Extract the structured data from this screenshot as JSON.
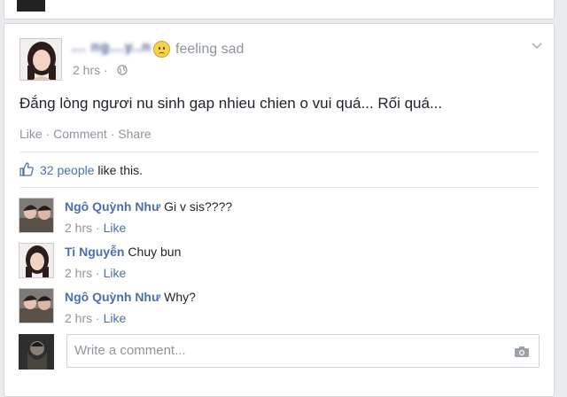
{
  "post": {
    "author": "... ng...y..n",
    "feeling": "feeling sad",
    "time": "2 hrs ·",
    "text": "Đắng lòng ngươi nu sinh gap nhieu chien o vui quá... Rối quá...",
    "actions": {
      "like": "Like",
      "sep1": " · ",
      "comment": "Comment",
      "sep2": " · ",
      "share": "Share"
    },
    "likes": {
      "count": "32 people",
      "suffix": " like this."
    }
  },
  "comments": [
    {
      "name": "Ngô Quỳnh Như",
      "text": "Gi v sis????",
      "time": "2 hrs ·",
      "like": "Like"
    },
    {
      "name": "Ti Nguyễn",
      "text": "Chuy bun",
      "time": "2 hrs ·",
      "like": "Like"
    },
    {
      "name": "Ngô Quỳnh Như",
      "text": "Why?",
      "time": "2 hrs ·",
      "like": "Like"
    }
  ],
  "composer": {
    "placeholder": "Write a comment..."
  },
  "icons": {
    "feeling": "sad-emoji-icon",
    "privacy": "globe-icon",
    "menu": "chevron-down-icon",
    "likes": "thumbs-up-icon",
    "attach": "camera-icon"
  },
  "colors": {
    "link": "#4b6ea9",
    "muted": "#90949c",
    "text": "#1d2129"
  }
}
